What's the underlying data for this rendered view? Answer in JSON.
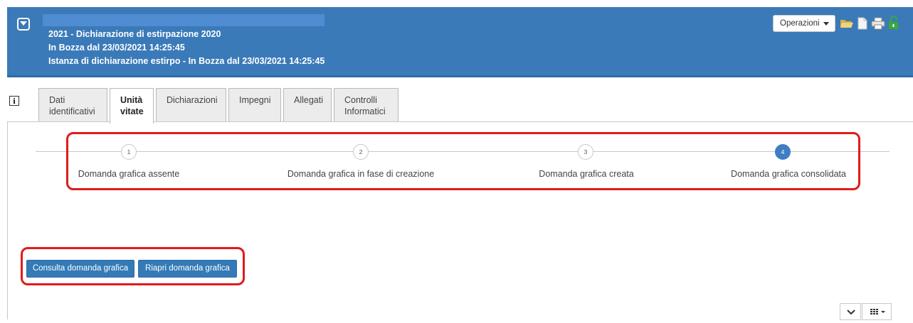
{
  "header": {
    "title": "2021 - Dichiarazione di estirpazione 2020",
    "status": "In Bozza dal 23/03/2021 14:25:45",
    "instance": "Istanza di dichiarazione estirpo - In Bozza dal 23/03/2021 14:25:45",
    "operations_label": "Operazioni",
    "icons": [
      "folder-open-icon",
      "document-icon",
      "printer-icon",
      "unlock-icon"
    ],
    "accent_color": "#3a7ab8"
  },
  "tabs": [
    {
      "line1": "Dati",
      "line2": "identificativi",
      "active": false
    },
    {
      "line1": "Unità",
      "line2": "vitate",
      "active": true
    },
    {
      "line1": "Dichiarazioni",
      "line2": "",
      "active": false
    },
    {
      "line1": "Impegni",
      "line2": "",
      "active": false
    },
    {
      "line1": "Allegati",
      "line2": "",
      "active": false
    },
    {
      "line1": "Controlli",
      "line2": "Informatici",
      "active": false
    }
  ],
  "info_label": "i",
  "stepper": {
    "current_step": 4,
    "steps": [
      {
        "number": "1",
        "label": "Domanda grafica assente"
      },
      {
        "number": "2",
        "label": "Domanda grafica in fase di creazione"
      },
      {
        "number": "3",
        "label": "Domanda grafica creata"
      },
      {
        "number": "4",
        "label": "Domanda grafica consolidata"
      }
    ]
  },
  "actions": {
    "consult_label": "Consulta domanda grafica",
    "reopen_label": "Riapri domanda grafica"
  },
  "highlight_color": "#e01b1b"
}
